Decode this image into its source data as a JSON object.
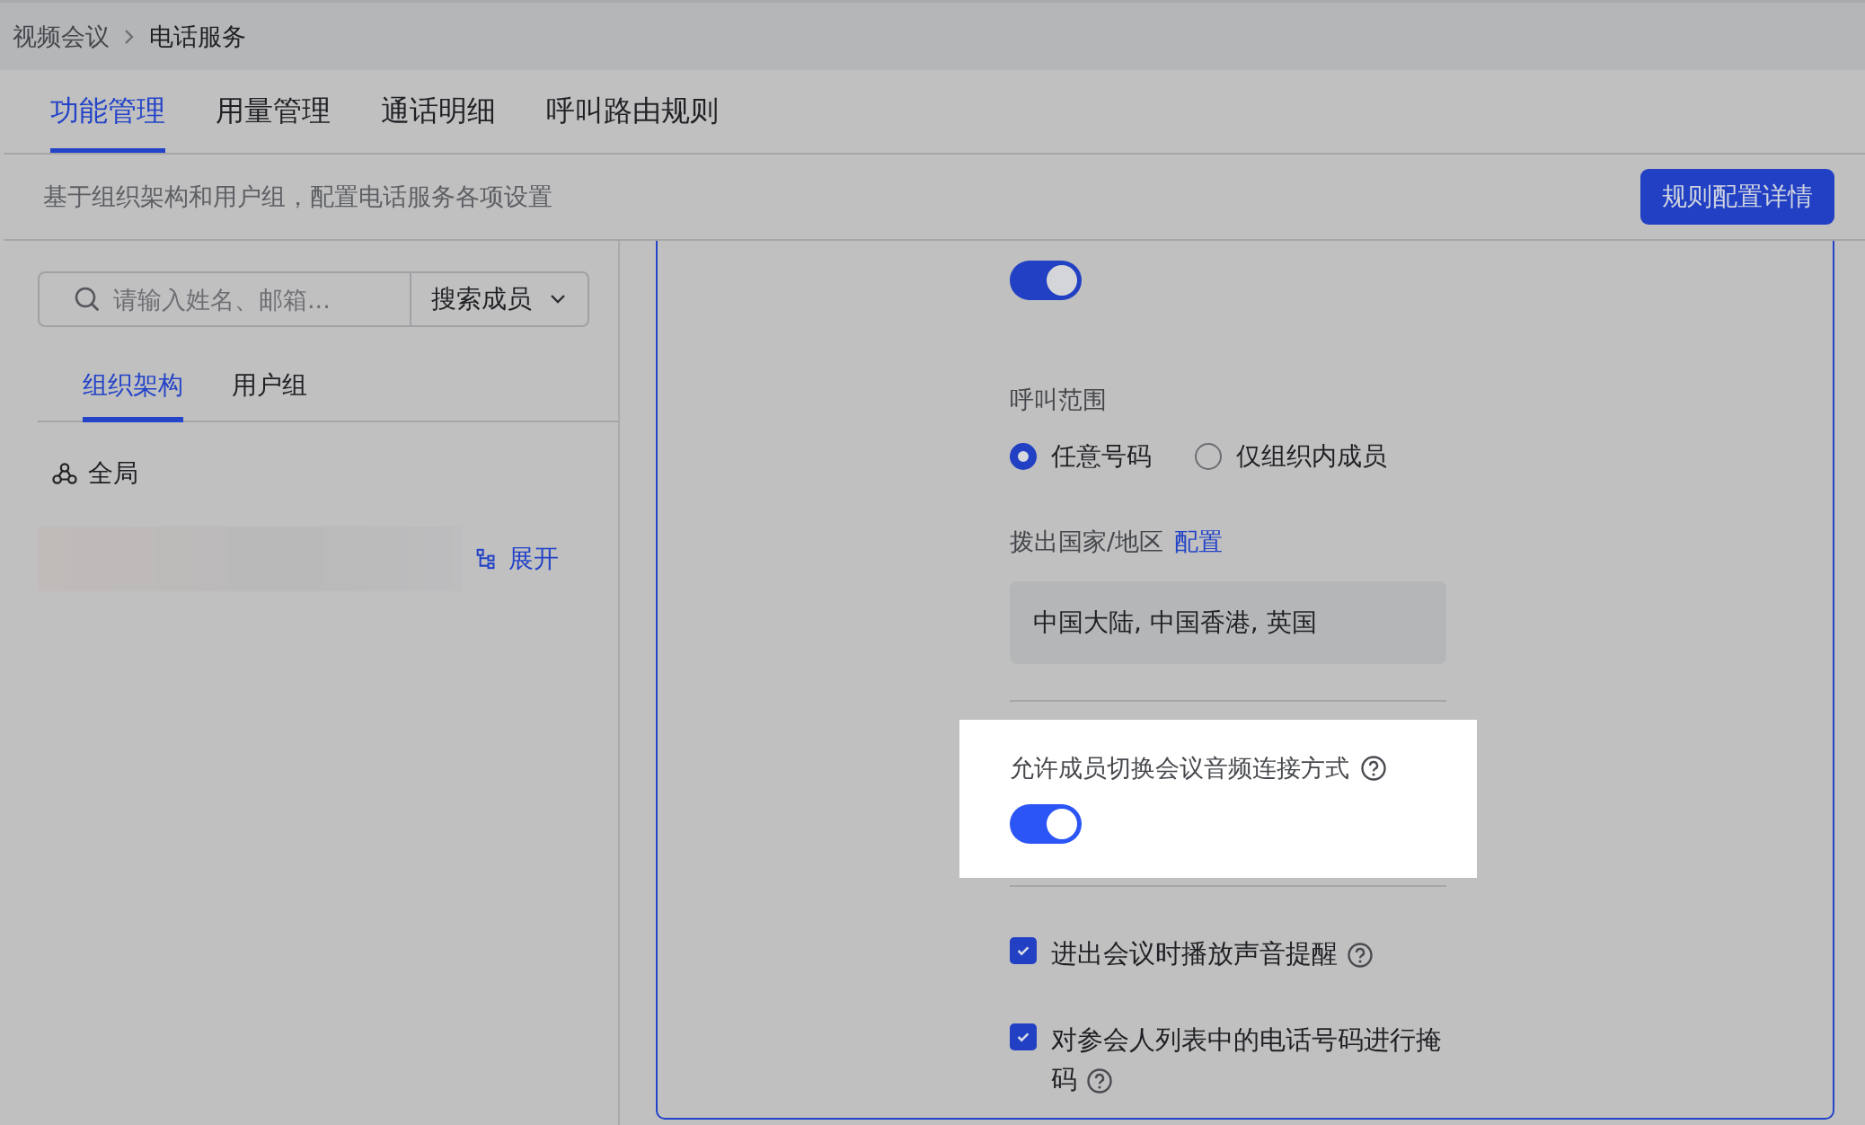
{
  "breadcrumb": [
    {
      "label": "视频会议"
    },
    {
      "label": "电话服务"
    }
  ],
  "tabs": [
    {
      "label": "功能管理",
      "selected": true
    },
    {
      "label": "用量管理",
      "selected": false
    },
    {
      "label": "通话明细",
      "selected": false
    },
    {
      "label": "呼叫路由规则",
      "selected": false
    }
  ],
  "description": "基于组织架构和用户组，配置电话服务各项设置",
  "rules_button": "规则配置详情",
  "search": {
    "placeholder": "请输入姓名、邮箱...",
    "scope": "搜索成员"
  },
  "side_tabs": [
    {
      "label": "组织架构",
      "selected": true
    },
    {
      "label": "用户组",
      "selected": false
    }
  ],
  "tree_root": "全局",
  "expand_link": "展开",
  "settings": [
    {
      "kind": "toggle",
      "on": true
    },
    {
      "kind": "radio",
      "label": "呼叫范围",
      "options": [
        {
          "label": "任意号码",
          "selected": true
        },
        {
          "label": "仅组织内成员",
          "selected": false
        }
      ]
    },
    {
      "kind": "countries",
      "label": "拨出国家/地区",
      "link": "配置",
      "value": "中国大陆, 中国香港, 英国"
    },
    {
      "kind": "toggle",
      "label": "允许成员切换会议音频连接方式",
      "on": true,
      "highlighted": true,
      "help": true
    },
    {
      "kind": "checkbox",
      "label": "进出会议时播放声音提醒",
      "checked": true,
      "help": true
    },
    {
      "kind": "checkbox",
      "label": "对参会人列表中的电话号码进行掩码",
      "checked": true,
      "help": true
    }
  ]
}
